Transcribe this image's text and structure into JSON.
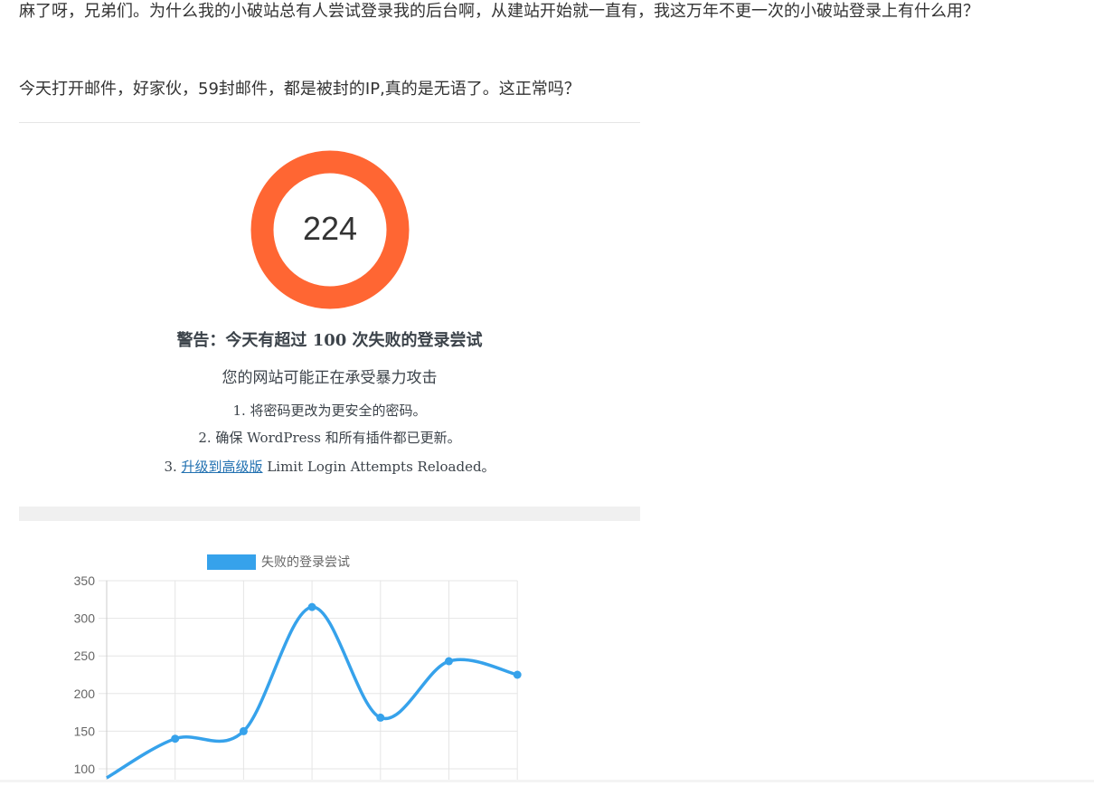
{
  "post": {
    "paragraph1": "麻了呀，兄弟们。为什么我的小破站总有人尝试登录我的后台啊，从建站开始就一直有，我这万年不更一次的小破站登录上有什么用？",
    "paragraph2": "今天打开邮件，好家伙，59封邮件，都是被封的IP,真的是无语了。这正常吗？"
  },
  "alert": {
    "failed_count": "224",
    "donut_color": "#ff6633",
    "title": "警告：今天有超过 100 次失败的登录尝试",
    "subtitle": "您的网站可能正在承受暴力攻击",
    "step1": "1. 将密码更改为更安全的密码。",
    "step2": "2. 确保 WordPress 和所有插件都已更新。",
    "step3_prefix": "3. ",
    "step3_link": "升级到高级版",
    "step3_suffix": " Limit Login Attempts Reloaded。"
  },
  "chart_data": {
    "type": "line",
    "x": [
      0,
      1,
      2,
      3,
      4,
      5,
      6
    ],
    "series": [
      {
        "name": "失败的登录尝试",
        "values": [
          88,
          140,
          150,
          315,
          168,
          243,
          225
        ],
        "color": "#36a2eb"
      }
    ],
    "y_ticks": [
      "100",
      "150",
      "200",
      "250",
      "300",
      "350"
    ],
    "ylim": [
      80,
      350
    ],
    "grid": true,
    "smooth": true,
    "legend_position": "top"
  }
}
